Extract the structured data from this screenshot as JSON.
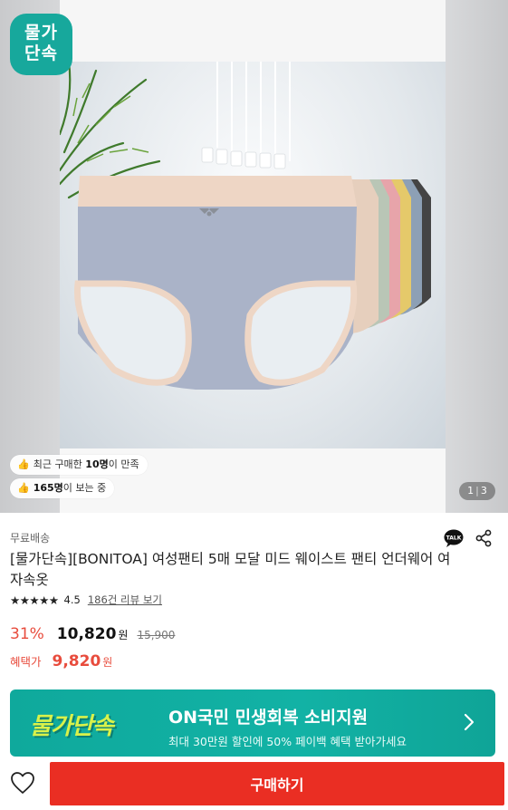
{
  "gallery": {
    "badge_text": "물가\n단속",
    "badge_line1": "물가",
    "badge_line2": "단속",
    "pill_recent": {
      "prefix": "최근 구매한 ",
      "bold": "10명",
      "suffix": "이 만족"
    },
    "pill_viewing": {
      "bold": "165명",
      "suffix": "이 보는 중"
    },
    "pager": {
      "current": "1",
      "total": "3"
    },
    "hand_icon": "thumbs-up-hand"
  },
  "product": {
    "shipping": "무료배송",
    "title": "[물가단속][BONITOA] 여성팬티 5매 모달 미드 웨이스트 팬티 언더웨어 여자속옷",
    "rating": {
      "stars": "★★★★★",
      "score": "4.5",
      "reviews": "186건 리뷰 보기"
    },
    "price": {
      "discount": "31%",
      "sale": "10,820",
      "sale_unit": "원",
      "original": "15,900",
      "benefit_label": "혜택가",
      "benefit": "9,820",
      "benefit_unit": "원"
    },
    "icons": {
      "talk": "TALK",
      "share": "share-icon"
    }
  },
  "banner": {
    "logo": "물가단속",
    "headline": "ON국민 민생회복 소비지원",
    "sub": "최대 30만원 할인에 50% 페이백 혜택 받아가세요"
  },
  "bottom": {
    "buy_label": "구매하기"
  },
  "colors": {
    "accent_red": "#ea2e23",
    "discount_red": "#e84c3d",
    "teal": "#12b2a5",
    "lime": "#d9f24a"
  }
}
